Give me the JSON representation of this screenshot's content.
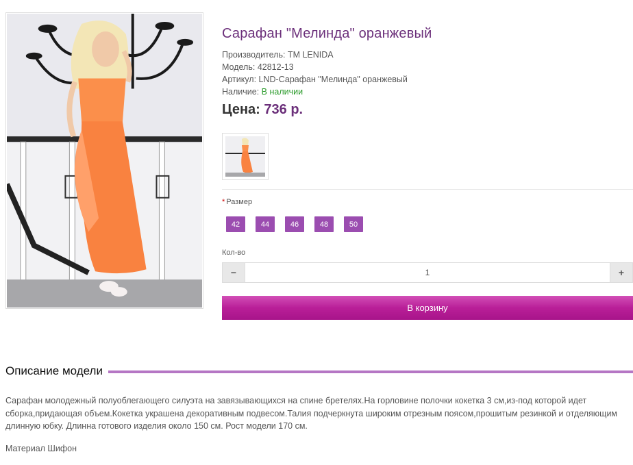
{
  "product": {
    "title": "Сарафан \"Мелинда\" оранжевый",
    "manufacturer": "Производитель: ТМ LENIDA",
    "model": "Модель: 42812-13",
    "sku": "Артикул: LND-Сарафан \"Мелинда\" оранжевый",
    "availability_label": "Наличие: ",
    "availability_value": "В наличии",
    "price_label": "Цена: ",
    "price_value": "736 р."
  },
  "options": {
    "size_required_mark": "*",
    "size_label": "Размер",
    "sizes": [
      "42",
      "44",
      "46",
      "48",
      "50"
    ]
  },
  "quantity": {
    "label": "Кол-во",
    "minus": "−",
    "value": "1",
    "plus": "+"
  },
  "cart": {
    "button_label": "В корзину"
  },
  "description": {
    "heading": "Описание модели",
    "text": "Сарафан молодежный полуоблегающего силуэта на завязывающихся на спине бретелях.На горловине полочки кокетка 3 см,из-под которой идет сборка,придающая объем.Кокетка украшена декоративным подвесом.Талия подчеркнута широким отрезным поясом,прошитым резинкой и отделяющим длинную юбку. Длинна готового изделия около 150 см. Рост модели 170 см.",
    "material": "Материал Шифон"
  },
  "colors": {
    "accent": "#6b2f7a",
    "size_button": "#9b4db0",
    "cart_button": "#b91f98",
    "in_stock": "#2a9a2a"
  }
}
